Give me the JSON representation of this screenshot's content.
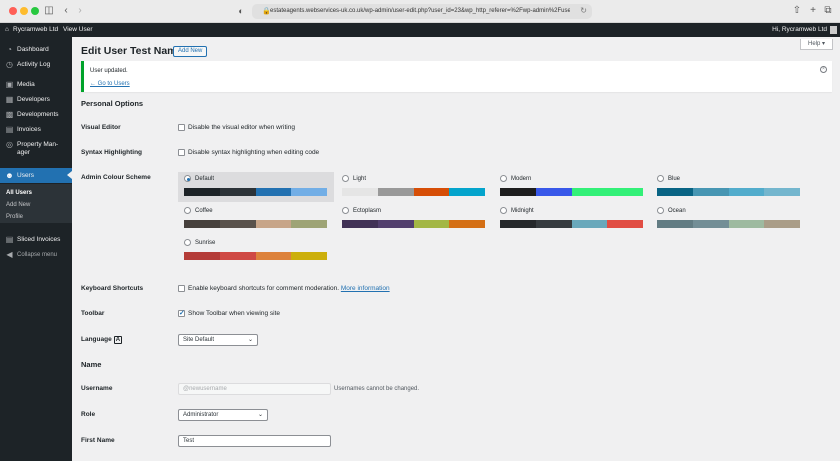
{
  "browser": {
    "url": "estateagents.webservices-uk.co.uk/wp-admin/user-edit.php?user_id=23&wp_http_referer=%2Fwp-admin%2Fusers..."
  },
  "adminbar": {
    "site_name": "Rycramweb Ltd",
    "view_user": "View User",
    "greeting": "Hi, Rycramweb Ltd"
  },
  "sidebar": {
    "items": [
      {
        "label": "Dashboard",
        "icon": "dashboard-icon"
      },
      {
        "label": "Activity Log",
        "icon": "activity-icon"
      },
      {
        "label": "Media",
        "icon": "media-icon"
      },
      {
        "label": "Developers",
        "icon": "developers-icon"
      },
      {
        "label": "Developments",
        "icon": "developments-icon"
      },
      {
        "label": "Invoices",
        "icon": "invoices-icon"
      },
      {
        "label": "Property Man-ager",
        "icon": "property-icon"
      },
      {
        "label": "Users",
        "icon": "users-icon"
      },
      {
        "label": "Sliced Invoices",
        "icon": "sliced-invoices-icon"
      },
      {
        "label": "Collapse menu",
        "icon": "collapse-icon"
      }
    ],
    "users_submenu": [
      "All Users",
      "Add New",
      "Profile"
    ]
  },
  "help_label": "Help ▾",
  "page_title": "Edit User Test Name",
  "add_new_label": "Add New",
  "notice": {
    "message": "User updated.",
    "link": "← Go to Users"
  },
  "personal_options": {
    "heading": "Personal Options",
    "visual_editor": {
      "label": "Visual Editor",
      "option": "Disable the visual editor when writing",
      "checked": false
    },
    "syntax_highlighting": {
      "label": "Syntax Highlighting",
      "option": "Disable syntax highlighting when editing code",
      "checked": false
    },
    "admin_colour_scheme": {
      "label": "Admin Colour Scheme",
      "selected": "Default",
      "schemes": [
        {
          "name": "Default",
          "colors": [
            "#1d2327",
            "#2c3338",
            "#2271b1",
            "#72aee6"
          ]
        },
        {
          "name": "Light",
          "colors": [
            "#e5e5e5",
            "#999999",
            "#d64e07",
            "#04a4cc"
          ]
        },
        {
          "name": "Modern",
          "colors": [
            "#1e1e1e",
            "#3858e9",
            "#33f078",
            "#33f078"
          ]
        },
        {
          "name": "Blue",
          "colors": [
            "#096484",
            "#4796b3",
            "#52accc",
            "#74b6ce"
          ]
        },
        {
          "name": "Coffee",
          "colors": [
            "#46403c",
            "#59524c",
            "#c7a589",
            "#9ea476"
          ]
        },
        {
          "name": "Ectoplasm",
          "colors": [
            "#413256",
            "#523f6d",
            "#a3b745",
            "#d46f15"
          ]
        },
        {
          "name": "Midnight",
          "colors": [
            "#25282b",
            "#363b3f",
            "#69a8bb",
            "#e14d43"
          ]
        },
        {
          "name": "Ocean",
          "colors": [
            "#627c83",
            "#738e96",
            "#9ebaa0",
            "#aa9d88"
          ]
        },
        {
          "name": "Sunrise",
          "colors": [
            "#b43c38",
            "#cf4944",
            "#dd823b",
            "#ccaf0b"
          ]
        }
      ]
    },
    "keyboard_shortcuts": {
      "label": "Keyboard Shortcuts",
      "option": "Enable keyboard shortcuts for comment moderation.",
      "link": "More information",
      "checked": false
    },
    "toolbar": {
      "label": "Toolbar",
      "option": "Show Toolbar when viewing site",
      "checked": true
    },
    "language": {
      "label": "Language",
      "value": "Site Default"
    }
  },
  "name_section": {
    "heading": "Name",
    "username": {
      "label": "Username",
      "placeholder": "@newusername",
      "note": "Usernames cannot be changed."
    },
    "role": {
      "label": "Role",
      "value": "Administrator"
    },
    "first_name": {
      "label": "First Name",
      "value": "Test"
    }
  }
}
